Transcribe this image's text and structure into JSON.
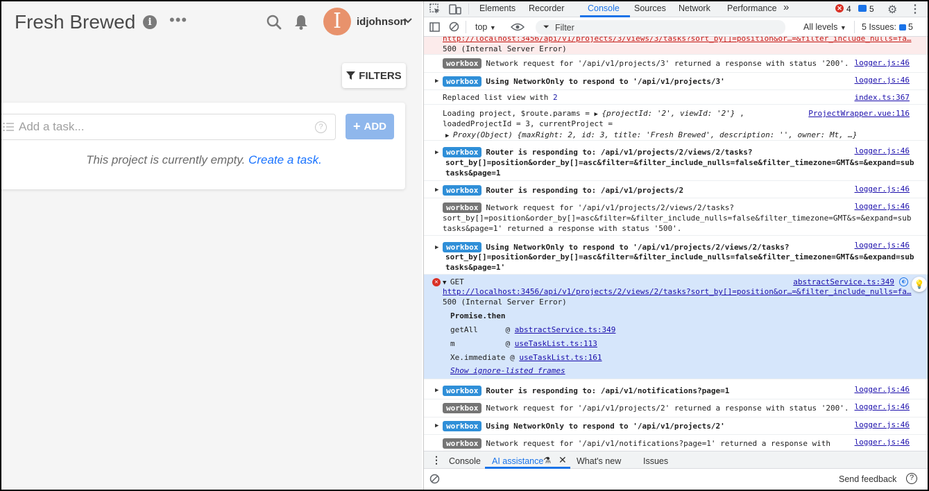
{
  "app": {
    "title": "Fresh Brewed",
    "username": "idjohnson",
    "avatar_letter": "I",
    "avatar_color": "#e8926c",
    "filters_label": "FILTERS",
    "task_placeholder": "Add a task...",
    "add_label": "ADD",
    "empty_text": "This project is currently empty.",
    "create_link": "Create a task."
  },
  "devtools": {
    "tabs": [
      "Elements",
      "Recorder",
      "Console",
      "Sources",
      "Network",
      "Performance"
    ],
    "active_tab": "Console",
    "more_tabs": "»",
    "error_count": "4",
    "message_count": "5",
    "toolbar": {
      "context": "top",
      "filter_placeholder": "Filter",
      "levels": "All levels",
      "issues_label": "5 Issues:",
      "issues_count": "5"
    },
    "console": {
      "r0": {
        "url": "http://localhost:3456/api/v1/projects/3/views/3/tasks?sort_by[]=position&or…=&filter_include_nulls=fa…",
        "status": "500 (Internal Server Error)"
      },
      "r1": {
        "badge": "workbox",
        "text": "Network request for '/api/v1/projects/3' returned a response with status '200'.",
        "src": "logger.js:46"
      },
      "r2": {
        "badge": "workbox",
        "text": "Using NetworkOnly to respond to '/api/v1/projects/3'",
        "src": "logger.js:46"
      },
      "r3": {
        "text_a": "Replaced list view with ",
        "text_b": "2",
        "src": "index.ts:367"
      },
      "r4": {
        "l1a": "Loading project, $route.params = ",
        "l1b": "{projectId: '2', viewId: '2'}",
        "l1c": " ,",
        "l2": "loadedProjectId = 3, currentProject =",
        "l3": "Proxy(Object) {maxRight: 2, id: 3, title: 'Fresh Brewed', description: '', owner: Mt, …}",
        "src": "ProjectWrapper.vue:116"
      },
      "r5": {
        "badge": "workbox",
        "l1": "Router is responding to: /api/v1/projects/2/views/2/tasks?",
        "l2": "sort_by[]=position&order_by[]=asc&filter=&filter_include_nulls=false&filter_timezone=GMT&s=&expand=sub",
        "l3": "tasks&page=1",
        "src": "logger.js:46"
      },
      "r6": {
        "badge": "workbox",
        "text": "Router is responding to: /api/v1/projects/2",
        "src": "logger.js:46"
      },
      "r7": {
        "badge": "workbox",
        "l1": "Network request for '/api/v1/projects/2/views/2/tasks?",
        "l2": "sort_by[]=position&order_by[]=asc&filter=&filter_include_nulls=false&filter_timezone=GMT&s=&expand=sub",
        "l3": "tasks&page=1' returned a response with status '500'.",
        "src": "logger.js:46"
      },
      "r8": {
        "badge": "workbox",
        "l1": "Using NetworkOnly to respond to '/api/v1/projects/2/views/2/tasks?",
        "l2": "sort_by[]=position&order_by[]=asc&filter=&filter_include_nulls=false&filter_timezone=GMT&s=&expand=sub",
        "l3": "tasks&page=1'",
        "src": "logger.js:46"
      },
      "r9": {
        "method": "GET",
        "url": "http://localhost:3456/api/v1/projects/2/views/2/tasks?sort_by[]=position&or…=&filter_include_nulls=fa…",
        "status": "500 (Internal Server Error)",
        "src": "abstractService.ts:349",
        "promise": "Promise.then",
        "frames": [
          {
            "fn": "getAll      @ ",
            "loc": "abstractService.ts:349"
          },
          {
            "fn": "m           @ ",
            "loc": "useTaskList.ts:113"
          },
          {
            "fn": "Xe.immediate @ ",
            "loc": "useTaskList.ts:161"
          }
        ],
        "show_frames": "Show ignore-listed frames"
      },
      "r10": {
        "badge": "workbox",
        "text": "Router is responding to: /api/v1/notifications?page=1",
        "src": "logger.js:46"
      },
      "r11": {
        "badge": "workbox",
        "text": "Network request for '/api/v1/projects/2' returned a response with status '200'.",
        "src": "logger.js:46"
      },
      "r12": {
        "badge": "workbox",
        "text": "Using NetworkOnly to respond to '/api/v1/projects/2'",
        "src": "logger.js:46"
      },
      "r13": {
        "badge": "workbox",
        "text": "Network request for '/api/v1/notifications?page=1' returned a response with",
        "src": "logger.js:46"
      }
    },
    "drawer": {
      "tabs": [
        "Console",
        "AI assistance",
        "What's new",
        "Issues"
      ],
      "active": "AI assistance"
    },
    "send_feedback": "Send feedback"
  }
}
